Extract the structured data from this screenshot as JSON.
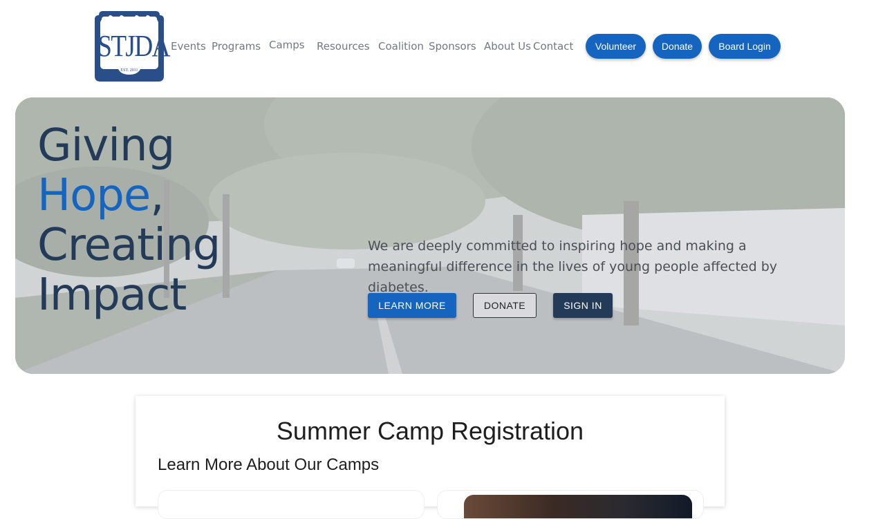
{
  "logo": {
    "text": "STJDA",
    "est": "EST. 2011",
    "color": "#2a4e88"
  },
  "nav": [
    {
      "label": "Events"
    },
    {
      "label": "Programs"
    },
    {
      "label": "Camps"
    },
    {
      "label": "Resources"
    },
    {
      "label": "Coalition"
    },
    {
      "label": "Sponsors"
    },
    {
      "label": "About Us"
    },
    {
      "label": "Contact"
    }
  ],
  "header_buttons": {
    "volunteer": "Volunteer",
    "donate": "Donate",
    "board_login": "Board Login"
  },
  "hero": {
    "headline_line1": "Giving",
    "headline_hope": "Hope",
    "headline_comma": ",",
    "headline_line3": "Creating",
    "headline_line4": "Impact",
    "tagline": "We are deeply committed to inspiring hope and making a meaningful difference in the lives of young people affected by diabetes.",
    "buttons": {
      "learn_more": "LEARN MORE",
      "donate": "DONATE",
      "sign_in": "SIGN IN"
    }
  },
  "registration": {
    "title": "Summer Camp Registration",
    "subtitle": "Learn More About Our Camps"
  },
  "colors": {
    "primary_blue": "#1565c0",
    "navy": "#233a58",
    "nav_text": "#707983"
  }
}
